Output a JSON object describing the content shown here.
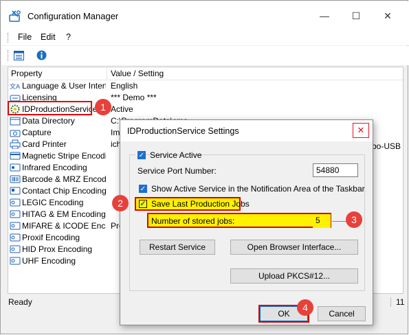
{
  "window": {
    "title": "Configuration Manager",
    "minimize": "—",
    "maximize": "☐",
    "close": "✕"
  },
  "menu": {
    "file": "File",
    "edit": "Edit",
    "help": "?"
  },
  "grid": {
    "headers": {
      "property": "Property",
      "value": "Value / Setting"
    },
    "rows": [
      {
        "name": "Language & User Interf...",
        "value": "English",
        "icon": "language-icon"
      },
      {
        "name": "Licensing",
        "value": "*** Demo ***",
        "icon": "license-icon"
      },
      {
        "name": "IDProductionService",
        "value": "Active",
        "icon": "gear-icon"
      },
      {
        "name": "Data Directory",
        "value": "C:\\ProgramData\\cms",
        "icon": "folder-icon"
      },
      {
        "name": "Capture",
        "value": "Ima",
        "icon": "camera-icon"
      },
      {
        "name": "Card Printer",
        "value": "ich",
        "icon": "printer-icon"
      },
      {
        "name": "Magnetic Stripe Encodi...",
        "value": "",
        "icon": "magstripe-icon"
      },
      {
        "name": "Infrared Encoding",
        "value": "",
        "icon": "infrared-icon"
      },
      {
        "name": "Barcode & MRZ Encodi...",
        "value": "",
        "icon": "barcode-icon"
      },
      {
        "name": "Contact Chip Encoding",
        "value": "",
        "icon": "chip-icon"
      },
      {
        "name": "LEGIC Encoding",
        "value": "",
        "icon": "card-icon"
      },
      {
        "name": "HITAG & EM Encoding",
        "value": "",
        "icon": "card-icon"
      },
      {
        "name": "MIFARE & ICODE Enc...",
        "value": "Pro",
        "icon": "card-icon"
      },
      {
        "name": "Proxif Encoding",
        "value": "",
        "icon": "card-icon"
      },
      {
        "name": "HID Prox Encoding",
        "value": "",
        "icon": "card-icon"
      },
      {
        "name": "UHF Encoding",
        "value": "",
        "icon": "card-icon"
      }
    ],
    "clipped_value_right": "bo-USB"
  },
  "status": {
    "text": "Ready",
    "right": "11"
  },
  "dialog": {
    "title": "IDProductionService Settings",
    "close": "✕",
    "service_active": {
      "label": "Service Active",
      "checked": true
    },
    "port_label": "Service Port Number:",
    "port_value": "54880",
    "show_active": {
      "label": "Show Active Service in the Notification Area of the Taskbar",
      "checked": true
    },
    "save_jobs": {
      "label": "Save Last Production Jobs",
      "checked": true
    },
    "stored_jobs_label": "Number of stored jobs:",
    "stored_jobs_value": "5",
    "restart_button": "Restart Service",
    "browser_button": "Open Browser Interface...",
    "upload_button": "Upload PKCS#12...",
    "ok_button": "OK",
    "cancel_button": "Cancel"
  },
  "badges": [
    "1",
    "2",
    "3",
    "4"
  ],
  "colors": {
    "highlight": "#fff200",
    "annotation_red": "#e8403a",
    "check_blue": "#1e6fd0"
  }
}
